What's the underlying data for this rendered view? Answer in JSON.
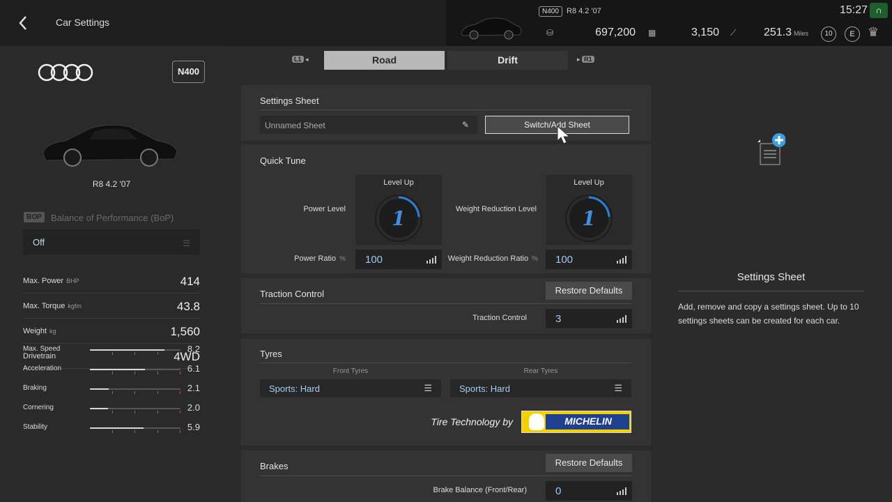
{
  "header": {
    "title": "Car Settings",
    "car": {
      "pp": "N400",
      "name": "R8 4.2 '07"
    },
    "credits": "697,200",
    "mileage_points": "3,150",
    "distance": "251.3",
    "distance_unit": "Miles",
    "level": "10",
    "license": "E",
    "clock": "15:27"
  },
  "left": {
    "pp": "N400",
    "car_name": "R8 4.2 '07",
    "bop": {
      "tag": "BOP",
      "label": "Balance of Performance (BoP)",
      "value": "Off"
    },
    "specs": [
      {
        "label": "Max. Power",
        "unit": "BHP",
        "value": "414"
      },
      {
        "label": "Max. Torque",
        "unit": "kgfm",
        "value": "43.8"
      },
      {
        "label": "Weight",
        "unit": "kg",
        "value": "1,560"
      },
      {
        "label": "Drivetrain",
        "unit": "",
        "value": "4WD"
      }
    ],
    "meters": [
      {
        "label": "Max. Speed",
        "value": "8.2",
        "fraction": 0.82
      },
      {
        "label": "Acceleration",
        "value": "6.1",
        "fraction": 0.61
      },
      {
        "label": "Braking",
        "value": "2.1",
        "fraction": 0.21
      },
      {
        "label": "Cornering",
        "value": "2.0",
        "fraction": 0.2
      },
      {
        "label": "Stability",
        "value": "5.9",
        "fraction": 0.59
      }
    ]
  },
  "tabs": {
    "left_hint": "L1",
    "right_hint": "R1",
    "road": "Road",
    "drift": "Drift",
    "active": "Road"
  },
  "settings_sheet": {
    "title": "Settings Sheet",
    "name": "Unnamed Sheet",
    "switch_label": "Switch/Add Sheet"
  },
  "quick_tune": {
    "title": "Quick Tune",
    "power_level_label": "Power Level",
    "power_level_up": "Level Up",
    "power_level": "1",
    "weight_level_label": "Weight Reduction Level",
    "weight_level_up": "Level Up",
    "weight_level": "1",
    "power_ratio_label": "Power Ratio",
    "power_ratio_unit": "%",
    "power_ratio": "100",
    "weight_ratio_label": "Weight Reduction Ratio",
    "weight_ratio_unit": "%",
    "weight_ratio": "100"
  },
  "traction": {
    "title": "Traction Control",
    "restore": "Restore Defaults",
    "label": "Traction Control",
    "value": "3"
  },
  "tyres": {
    "title": "Tyres",
    "front_head": "Front Tyres",
    "rear_head": "Rear Tyres",
    "front": "Sports: Hard",
    "rear": "Sports: Hard",
    "tech_by": "Tire Technology by",
    "brand": "MICHELIN"
  },
  "brakes": {
    "title": "Brakes",
    "restore": "Restore Defaults",
    "label": "Brake Balance (Front/Rear)",
    "value": "0"
  },
  "info": {
    "title": "Settings Sheet",
    "body": "Add, remove and copy a settings sheet. Up to 10 settings sheets can be created for each car."
  },
  "colors": {
    "accent_blue": "#2b7fd6",
    "value_blue": "#9fc8f2",
    "add_icon": "#3aa0e0",
    "michelin_yellow": "#f5d000",
    "michelin_blue": "#1f3f8f"
  },
  "icons": [
    "back-arrow-icon",
    "credits-icon",
    "mileage-icon",
    "distance-icon",
    "pencil-icon",
    "menu-icon",
    "bars-icon",
    "add-icon",
    "document-icon",
    "pointer-cursor-icon"
  ]
}
